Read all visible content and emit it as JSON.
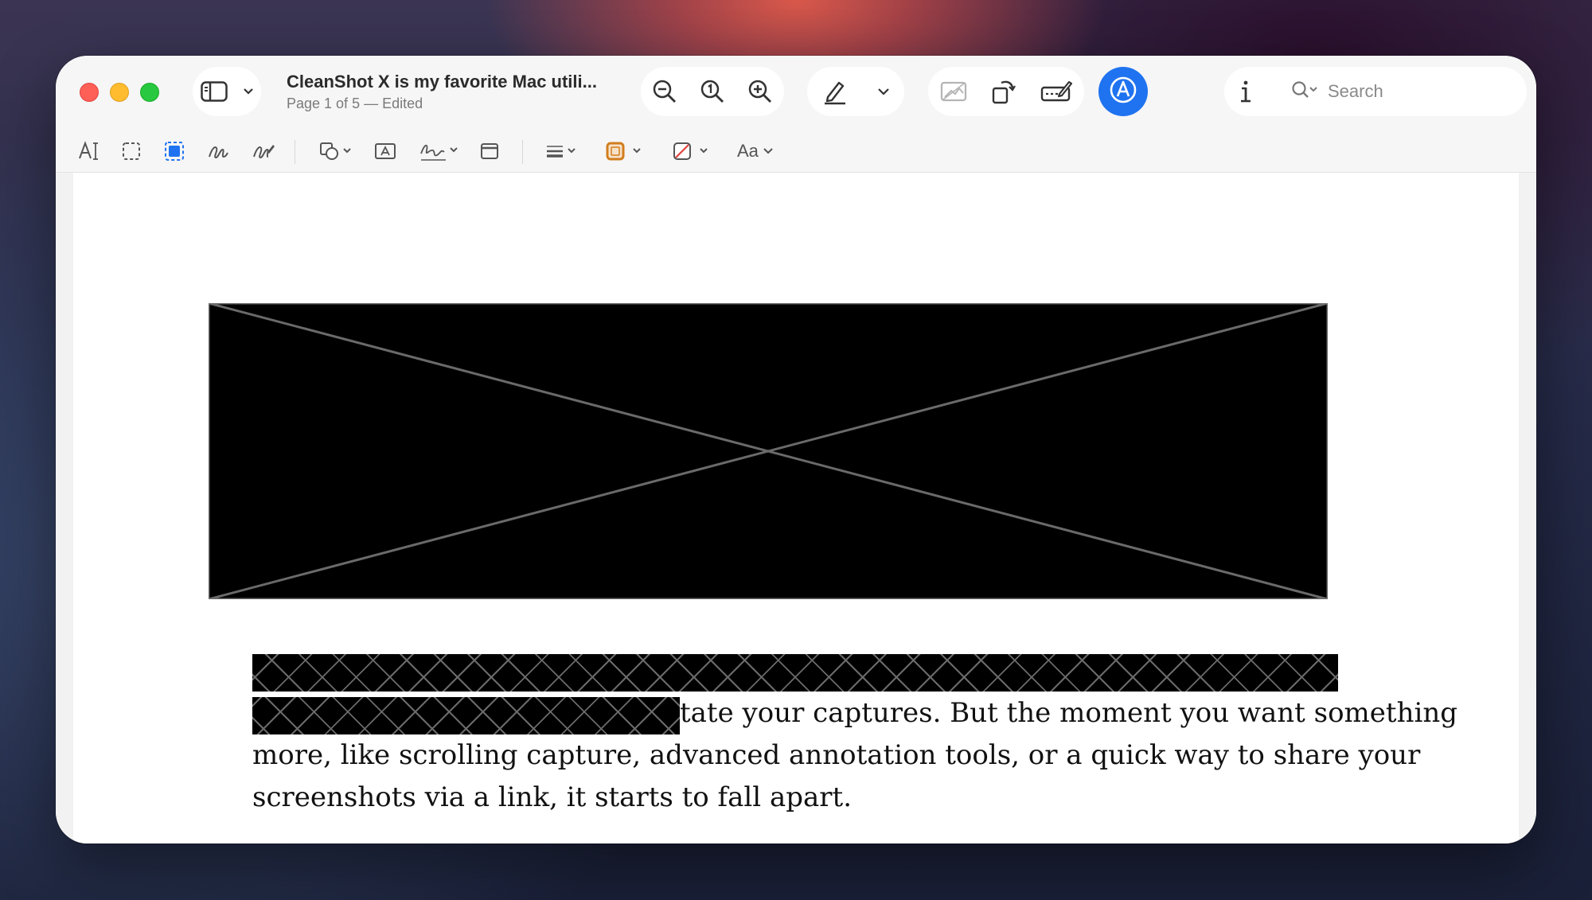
{
  "window": {
    "title": "CleanShot X is my favorite Mac utili...",
    "subtitle": "Page 1 of 5 — Edited"
  },
  "toolbar": {
    "sidebar_toggle": "sidebar-icon",
    "zoom_out": "zoom-out-icon",
    "actual_size": "actual-size-icon",
    "zoom_in": "zoom-in-icon",
    "highlight": "pencil-icon",
    "crop": "crop-icon",
    "rotate": "rotate-icon",
    "form_fill": "form-fill-icon",
    "markup": "markup-icon",
    "info": "i",
    "share": "share-icon"
  },
  "search": {
    "placeholder": "Search"
  },
  "markup_toolbar": {
    "text_selection": "A",
    "font_label": "Aa",
    "border_color": "#d27d1e",
    "accent": "#1f73f0"
  },
  "document": {
    "line1_visible": "tate your captures. But the moment you want something",
    "line2": "more, like scrolling capture, advanced annotation tools, or a quick way to share your",
    "line3": "screenshots via a link, it starts to fall apart."
  }
}
